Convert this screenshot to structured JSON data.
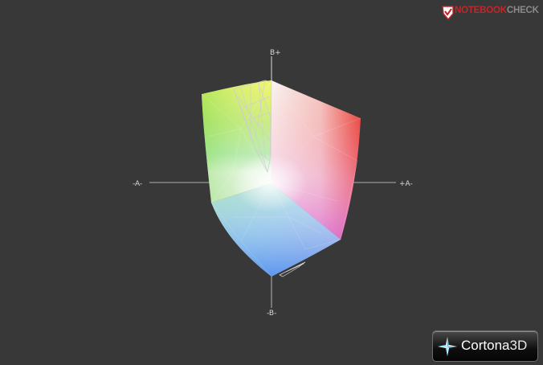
{
  "viewer": {
    "axes": {
      "top_label": "B+",
      "left_label": "-A-",
      "right_label": "+A-",
      "bottom_label": "-B-"
    }
  },
  "watermark": {
    "text_main": "NOTEBOOK",
    "text_accent": "CHECK",
    "icon": "notebookcheck-check-icon"
  },
  "badge": {
    "brand": "Cortona",
    "brand_suffix": "3D",
    "icon": "cortona-star-logo-icon"
  }
}
